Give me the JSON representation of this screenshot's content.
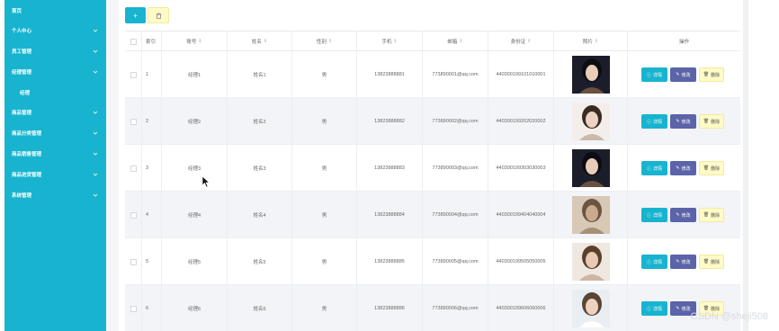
{
  "sidebar": {
    "items": [
      {
        "label": "首页",
        "has_chevron": false,
        "sub": false
      },
      {
        "label": "个人中心",
        "has_chevron": true,
        "sub": false
      },
      {
        "label": "员工管理",
        "has_chevron": true,
        "sub": false
      },
      {
        "label": "经理管理",
        "has_chevron": true,
        "sub": false
      },
      {
        "label": "经理",
        "has_chevron": false,
        "sub": true
      },
      {
        "label": "商品管理",
        "has_chevron": true,
        "sub": false
      },
      {
        "label": "商品分类管理",
        "has_chevron": true,
        "sub": false
      },
      {
        "label": "商品销售管理",
        "has_chevron": true,
        "sub": false
      },
      {
        "label": "商品进货管理",
        "has_chevron": true,
        "sub": false
      },
      {
        "label": "系统管理",
        "has_chevron": true,
        "sub": false
      }
    ]
  },
  "toolbar": {
    "add_icon": "plus-icon",
    "delete_icon": "trash-icon",
    "add_glyph": "+",
    "delete_glyph": "🗑"
  },
  "table": {
    "headers": {
      "index": "索引",
      "account": "账号",
      "name": "姓名",
      "gender": "性别",
      "phone": "手机",
      "email": "邮箱",
      "id_card": "身份证",
      "photo": "照片",
      "actions": "操作"
    },
    "sort_glyph": "⇕",
    "action_labels": {
      "detail": "详情",
      "edit": "修改",
      "delete": "删除"
    },
    "rows": [
      {
        "index": "1",
        "account": "经理1",
        "name": "姓名1",
        "gender": "男",
        "phone": "13823888881",
        "email": "773890001@qq.com",
        "id_card": "440300199101010001"
      },
      {
        "index": "2",
        "account": "经理2",
        "name": "姓名2",
        "gender": "男",
        "phone": "13823888882",
        "email": "773890002@qq.com",
        "id_card": "440300199202020002"
      },
      {
        "index": "3",
        "account": "经理3",
        "name": "姓名3",
        "gender": "男",
        "phone": "13823888883",
        "email": "773890003@qq.com",
        "id_card": "440300199303030003"
      },
      {
        "index": "4",
        "account": "经理4",
        "name": "姓名4",
        "gender": "男",
        "phone": "13823888884",
        "email": "773890004@qq.com",
        "id_card": "440300199404040004"
      },
      {
        "index": "5",
        "account": "经理5",
        "name": "姓名5",
        "gender": "男",
        "phone": "13823888885",
        "email": "773890005@qq.com",
        "id_card": "440300199505050005"
      },
      {
        "index": "6",
        "account": "经理6",
        "name": "姓名6",
        "gender": "男",
        "phone": "13823888886",
        "email": "773890006@qq.com",
        "id_card": "440300199606060006"
      }
    ]
  },
  "colors": {
    "accent": "#18b4cf",
    "edit_button": "#5b64a8",
    "delete_button": "#fffbc8",
    "row_alt": "#f3f4f7"
  },
  "watermark": "CSDN @sheji508"
}
